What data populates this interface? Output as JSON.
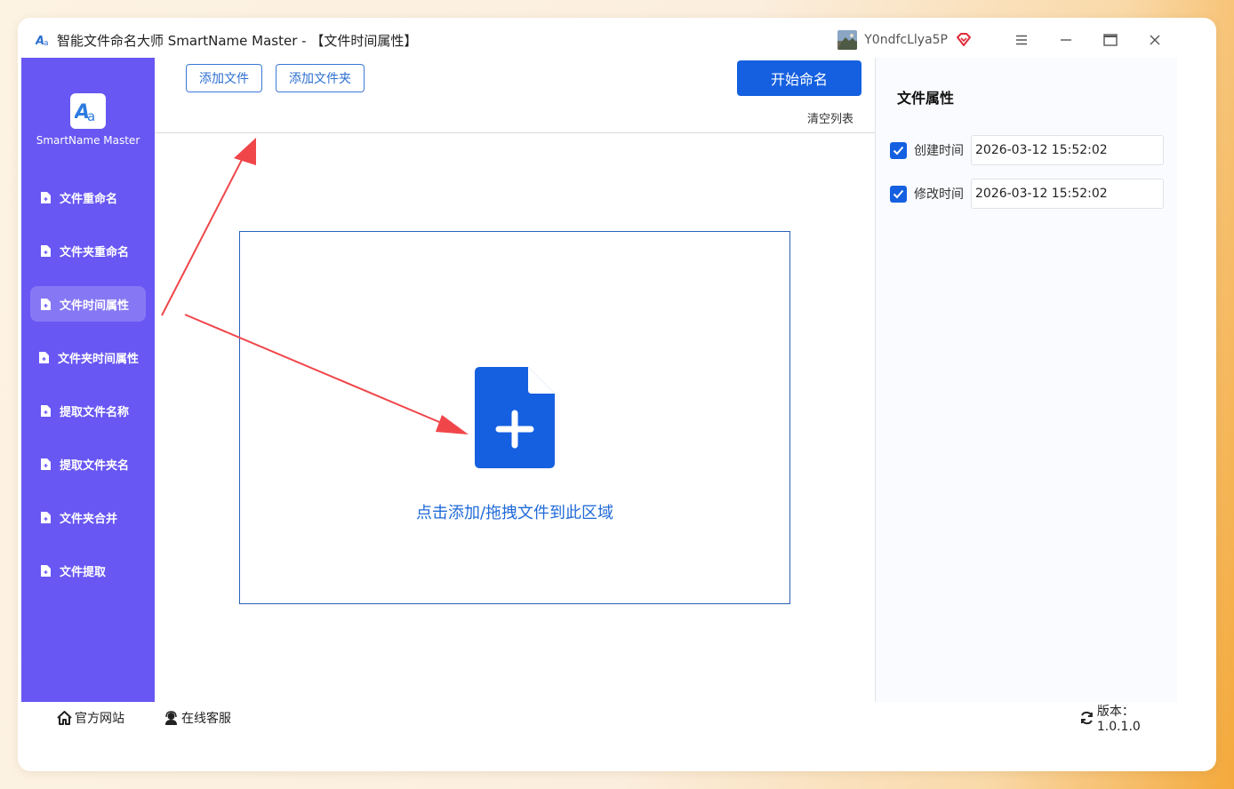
{
  "window": {
    "title": "智能文件命名大师 SmartName Master - 【文件时间属性】",
    "username": "Y0ndfcLlya5P"
  },
  "sidebar": {
    "logo_text": "SmartName Master",
    "items": [
      {
        "label": "文件重命名",
        "active": false
      },
      {
        "label": "文件夹重命名",
        "active": false
      },
      {
        "label": "文件时间属性",
        "active": true
      },
      {
        "label": "文件夹时间属性",
        "active": false
      },
      {
        "label": "提取文件名称",
        "active": false
      },
      {
        "label": "提取文件夹名",
        "active": false
      },
      {
        "label": "文件夹合并",
        "active": false
      },
      {
        "label": "文件提取",
        "active": false
      }
    ]
  },
  "toolbar": {
    "add_file_label": "添加文件",
    "add_folder_label": "添加文件夹",
    "start_label": "开始命名",
    "clear_label": "清空列表"
  },
  "dropzone": {
    "text": "点击添加/拖拽文件到此区域"
  },
  "properties": {
    "title": "文件属性",
    "created": {
      "label": "创建时间",
      "checked": true,
      "value": "2026-03-12 15:52:02"
    },
    "modified": {
      "label": "修改时间",
      "checked": true,
      "value": "2026-03-12 15:52:02"
    }
  },
  "statusbar": {
    "website_label": "官方网站",
    "support_label": "在线客服",
    "version_label": "版本：1.0.1.0"
  },
  "colors": {
    "sidebar": "#6857f2",
    "accent": "#1560e0",
    "annotation_arrow": "#f0464a"
  }
}
